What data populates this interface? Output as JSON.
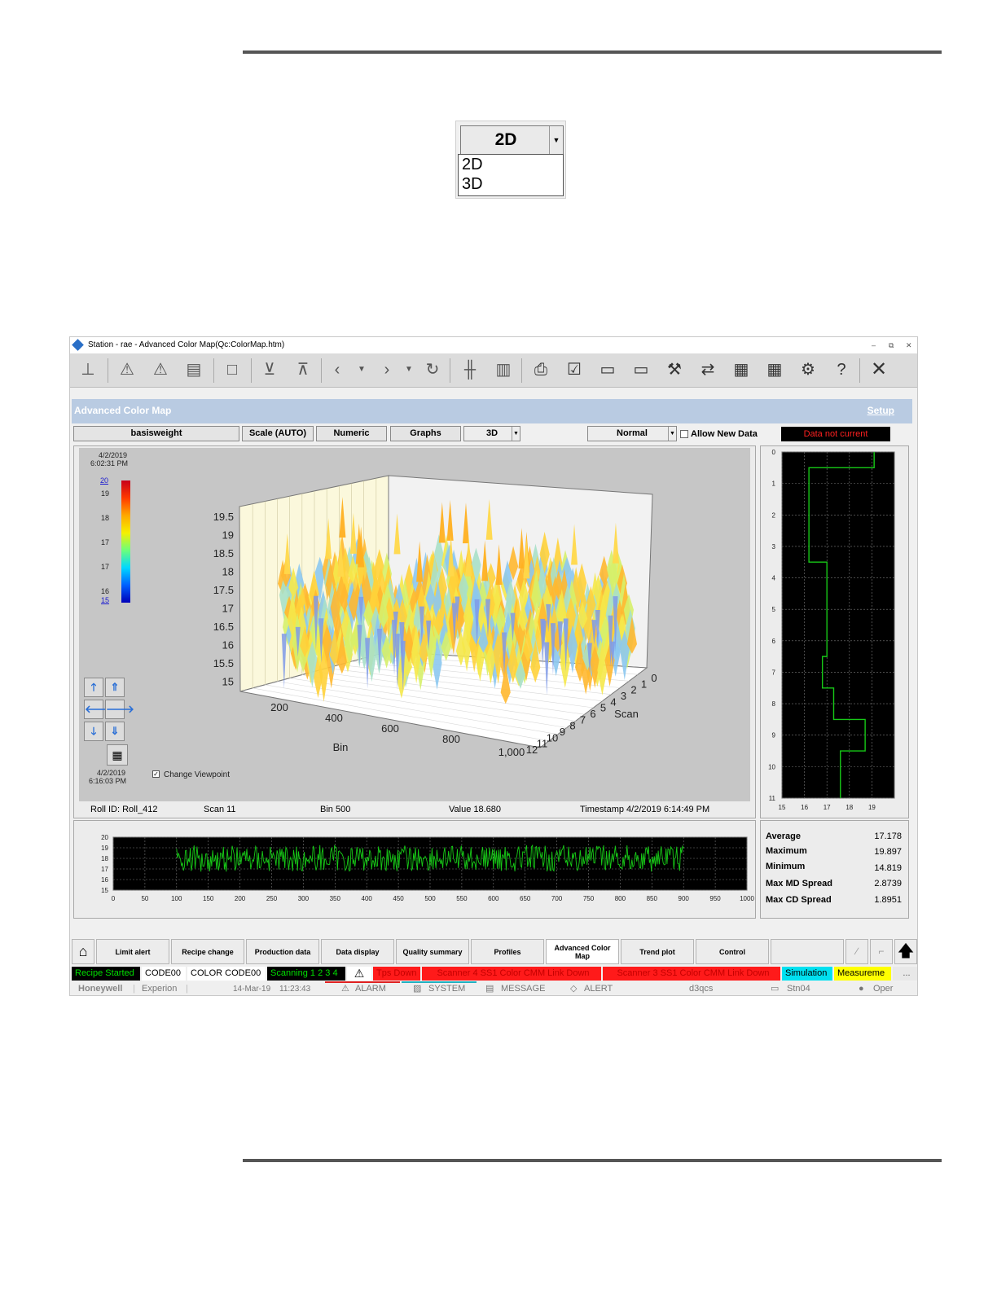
{
  "dropdown_inset": {
    "selected": "2D",
    "options": [
      "2D",
      "3D"
    ]
  },
  "window": {
    "title": "Station - rae - Advanced Color Map(Qc:ColorMap.htm)",
    "minimize": "–",
    "restore": "⧉",
    "close": "✕"
  },
  "header": {
    "title": "Advanced Color Map",
    "setup_link": "Setup"
  },
  "controls": {
    "measurement": "basisweight",
    "scale": "Scale (AUTO)",
    "numeric": "Numeric",
    "graphs": "Graphs",
    "view_mode": "3D",
    "display_mode": "Normal",
    "allow_new_data": "Allow New Data",
    "data_status": "Data not current"
  },
  "colormap": {
    "start_date": "4/2/2019",
    "start_time": "6:02:31 PM",
    "end_date": "4/2/2019",
    "end_time": "6:16:03 PM",
    "legend_max": "20",
    "legend_min": "15",
    "legend_ticks": [
      "19",
      "18",
      "17",
      "17",
      "16"
    ],
    "change_viewpoint": "Change Viewpoint",
    "z_ticks": [
      "19.5",
      "19",
      "18.5",
      "18",
      "17.5",
      "17",
      "16.5",
      "16",
      "15.5",
      "15"
    ],
    "bin_ticks": [
      "200",
      "400",
      "600",
      "800",
      "1,000"
    ],
    "bin_label": "Bin",
    "scan_ticks": [
      "0",
      "1",
      "2",
      "3",
      "4",
      "5",
      "6",
      "7",
      "8",
      "9",
      "10",
      "11",
      "12"
    ],
    "scan_label": "Scan",
    "surface_colors": [
      "#ffd23a",
      "#ffb830",
      "#f5e84a",
      "#d6f06a",
      "#a8e0c8",
      "#8cc8f0"
    ]
  },
  "info": {
    "roll": "Roll ID: Roll_412",
    "scan": "Scan 11",
    "bin": "Bin 500",
    "value": "Value 18.680",
    "timestamp": "Timestamp 4/2/2019 6:14:49 PM"
  },
  "profile": {
    "y_ticks": [
      "0",
      "1",
      "2",
      "3",
      "4",
      "5",
      "6",
      "7",
      "8",
      "9",
      "10",
      "11"
    ],
    "x_ticks": [
      "15",
      "16",
      "17",
      "18",
      "19"
    ],
    "values": [
      19.1,
      16.2,
      16.2,
      16.2,
      17.0,
      17.0,
      17.0,
      16.8,
      17.3,
      18.7,
      17.6,
      17.6
    ],
    "line_color": "#17c917"
  },
  "trend": {
    "y_ticks": [
      "20",
      "19",
      "18",
      "17",
      "16",
      "15"
    ],
    "x_ticks": [
      "0",
      "50",
      "100",
      "150",
      "200",
      "250",
      "300",
      "350",
      "400",
      "450",
      "500",
      "550",
      "600",
      "650",
      "700",
      "750",
      "800",
      "850",
      "900",
      "950",
      "1000"
    ],
    "line_color": "#17c917"
  },
  "stats": {
    "rows": [
      {
        "label": "Average",
        "value": "17.178"
      },
      {
        "label": "Maximum",
        "value": "19.897"
      },
      {
        "label": "Minimum",
        "value": "14.819"
      },
      {
        "label": "Max MD Spread",
        "value": "2.8739"
      },
      {
        "label": "Max CD Spread",
        "value": "1.8951"
      }
    ]
  },
  "nav": {
    "tabs": [
      "Limit alert",
      "Recipe change",
      "Production data",
      "Data display",
      "Quality summary",
      "Profiles",
      "Advanced Color Map",
      "Trend plot",
      "Control"
    ]
  },
  "status": {
    "recipe": "Recipe Started",
    "code": "CODE00",
    "color_code": "COLOR CODE00",
    "scanning": "Scanning 1 2 3 4",
    "tps": "Tps Down",
    "scanner4": "Scanner 4 SS1 Color CMM Link Down",
    "scanner3": "Scanner 3 SS1 Color CMM Link Down",
    "simulation": "Simulation",
    "measurement": "Measureme",
    "more": "..."
  },
  "footer": {
    "brand": "Honeywell",
    "product": "Experion",
    "date": "14-Mar-19",
    "time": "11:23:43",
    "alarm": "ALARM",
    "system": "SYSTEM",
    "message": "MESSAGE",
    "alert": "ALERT",
    "host": "d3qcs",
    "station": "Stn04",
    "user": "Oper"
  }
}
